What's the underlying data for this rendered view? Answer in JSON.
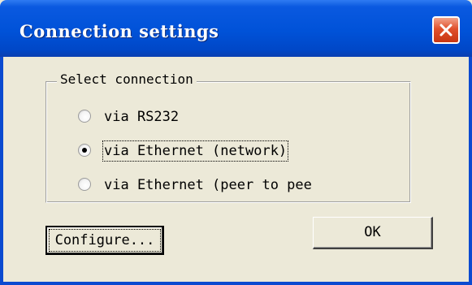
{
  "window": {
    "title": "Connection settings"
  },
  "group": {
    "label": "Select connection"
  },
  "options": [
    {
      "label": "via RS232",
      "selected": false
    },
    {
      "label": "via Ethernet (network)",
      "selected": true
    },
    {
      "label": "via Ethernet (peer to pee",
      "selected": false
    }
  ],
  "buttons": {
    "configure": "Configure...",
    "ok": "OK"
  },
  "colors": {
    "titlebar": "#0052d8",
    "close": "#e0502c",
    "face": "#ece9d8"
  },
  "icons": {
    "close": "close-icon"
  }
}
